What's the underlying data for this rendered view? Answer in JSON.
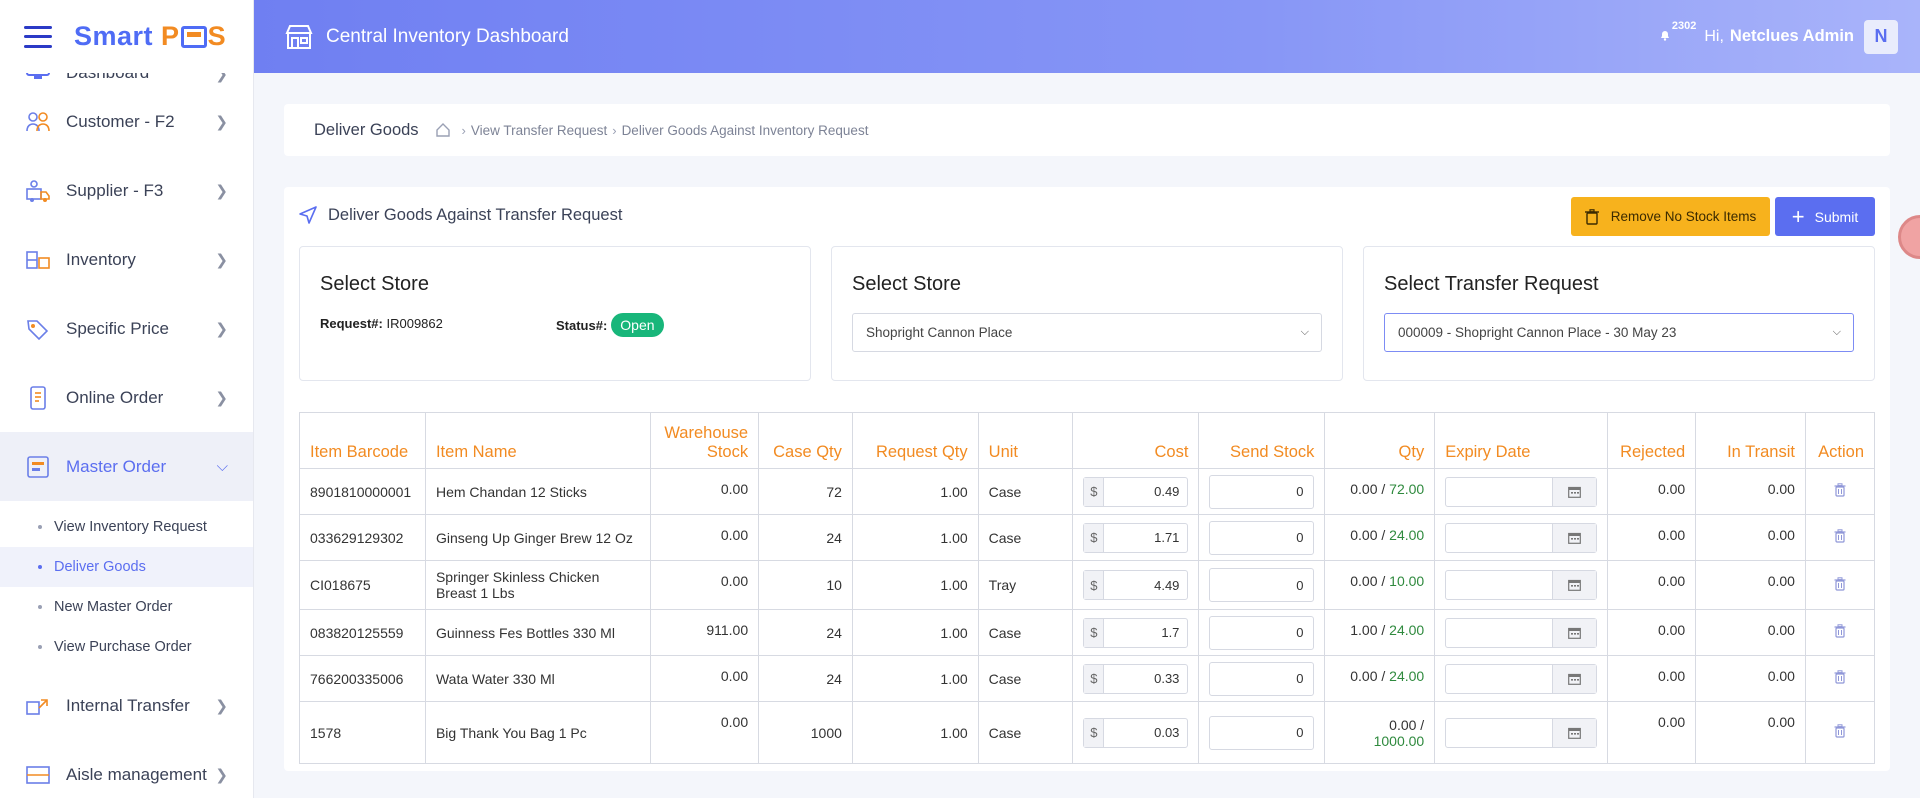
{
  "app": {
    "logo_text_1": "Smart",
    "logo_text_2": "P",
    "logo_text_3": "S"
  },
  "header": {
    "title": "Central Inventory Dashboard",
    "notif_count": "2302",
    "greeting": "Hi,",
    "user_name": "Netclues Admin",
    "avatar_letter": "N"
  },
  "sidebar": {
    "items": [
      {
        "label": "Dashboard",
        "icon": "monitor-icon"
      },
      {
        "label": "Customer - F2",
        "icon": "customers-icon"
      },
      {
        "label": "Supplier - F3",
        "icon": "supplier-icon"
      },
      {
        "label": "Inventory",
        "icon": "inventory-icon"
      },
      {
        "label": "Specific Price",
        "icon": "price-tag-icon"
      },
      {
        "label": "Online Order",
        "icon": "online-order-icon"
      },
      {
        "label": "Master Order",
        "icon": "master-order-icon"
      },
      {
        "label": "Internal Transfer",
        "icon": "transfer-icon"
      },
      {
        "label": "Aisle management",
        "icon": "aisle-icon"
      }
    ],
    "submenu": [
      {
        "label": "View Inventory Request"
      },
      {
        "label": "Deliver Goods"
      },
      {
        "label": "New Master Order"
      },
      {
        "label": "View Purchase Order"
      }
    ]
  },
  "breadcrumb": {
    "title": "Deliver Goods",
    "link1": "View Transfer Request",
    "link2": "Deliver Goods Against Inventory Request"
  },
  "card": {
    "title": "Deliver Goods Against Transfer Request",
    "remove_label": "Remove No Stock Items",
    "submit_label": "Submit"
  },
  "box1": {
    "title": "Select Store",
    "request_label": "Request#:",
    "request_value": "IR009862",
    "status_label": "Status#:",
    "status_value": "Open"
  },
  "box2": {
    "title": "Select Store",
    "selected": "Shopright Cannon Place"
  },
  "box3": {
    "title": "Select Transfer Request",
    "selected": "000009 - Shopright Cannon Place - 30 May 23"
  },
  "table": {
    "headers": {
      "barcode": "Item Barcode",
      "name": "Item Name",
      "warehouse_1": "Warehouse",
      "warehouse_2": "Stock",
      "case_qty": "Case Qty",
      "request_qty": "Request Qty",
      "unit": "Unit",
      "cost": "Cost",
      "send_stock": "Send Stock",
      "qty": "Qty",
      "expiry": "Expiry Date",
      "rejected": "Rejected",
      "in_transit": "In Transit",
      "action": "Action"
    },
    "currency": "$",
    "rows": [
      {
        "barcode": "8901810000001",
        "name": "Hem Chandan 12 Sticks",
        "warehouse": "0.00",
        "case_qty": "72",
        "request_qty": "1.00",
        "unit": "Case",
        "cost": "0.49",
        "send": "0",
        "qty_a": "0.00 /",
        "qty_b": "72.00",
        "rejected": "0.00",
        "in_transit": "0.00"
      },
      {
        "barcode": "033629129302",
        "name": "Ginseng Up Ginger Brew 12 Oz",
        "warehouse": "0.00",
        "case_qty": "24",
        "request_qty": "1.00",
        "unit": "Case",
        "cost": "1.71",
        "send": "0",
        "qty_a": "0.00 /",
        "qty_b": "24.00",
        "rejected": "0.00",
        "in_transit": "0.00"
      },
      {
        "barcode": "CI018675",
        "name": "Springer Skinless Chicken Breast 1 Lbs",
        "warehouse": "0.00",
        "case_qty": "10",
        "request_qty": "1.00",
        "unit": "Tray",
        "cost": "4.49",
        "send": "0",
        "qty_a": "0.00 /",
        "qty_b": "10.00",
        "rejected": "0.00",
        "in_transit": "0.00"
      },
      {
        "barcode": "083820125559",
        "name": "Guinness Fes Bottles 330 Ml",
        "warehouse": "911.00",
        "case_qty": "24",
        "request_qty": "1.00",
        "unit": "Case",
        "cost": "1.7",
        "send": "0",
        "qty_a": "1.00 /",
        "qty_b": "24.00",
        "rejected": "0.00",
        "in_transit": "0.00"
      },
      {
        "barcode": "766200335006",
        "name": "Wata Water 330 Ml",
        "warehouse": "0.00",
        "case_qty": "24",
        "request_qty": "1.00",
        "unit": "Case",
        "cost": "0.33",
        "send": "0",
        "qty_a": "0.00 /",
        "qty_b": "24.00",
        "rejected": "0.00",
        "in_transit": "0.00"
      },
      {
        "barcode": "1578",
        "name": "Big Thank You Bag 1 Pc",
        "warehouse": "0.00",
        "case_qty": "1000",
        "request_qty": "1.00",
        "unit": "Case",
        "cost": "0.03",
        "send": "0",
        "qty_a": "0.00 /",
        "qty_b": "1000.00",
        "rejected": "0.00",
        "in_transit": "0.00"
      }
    ]
  },
  "colors": {
    "accent": "#5b6ef0",
    "orange": "#f28b22",
    "status_green": "#18b67a",
    "warning": "#f7b21d"
  }
}
